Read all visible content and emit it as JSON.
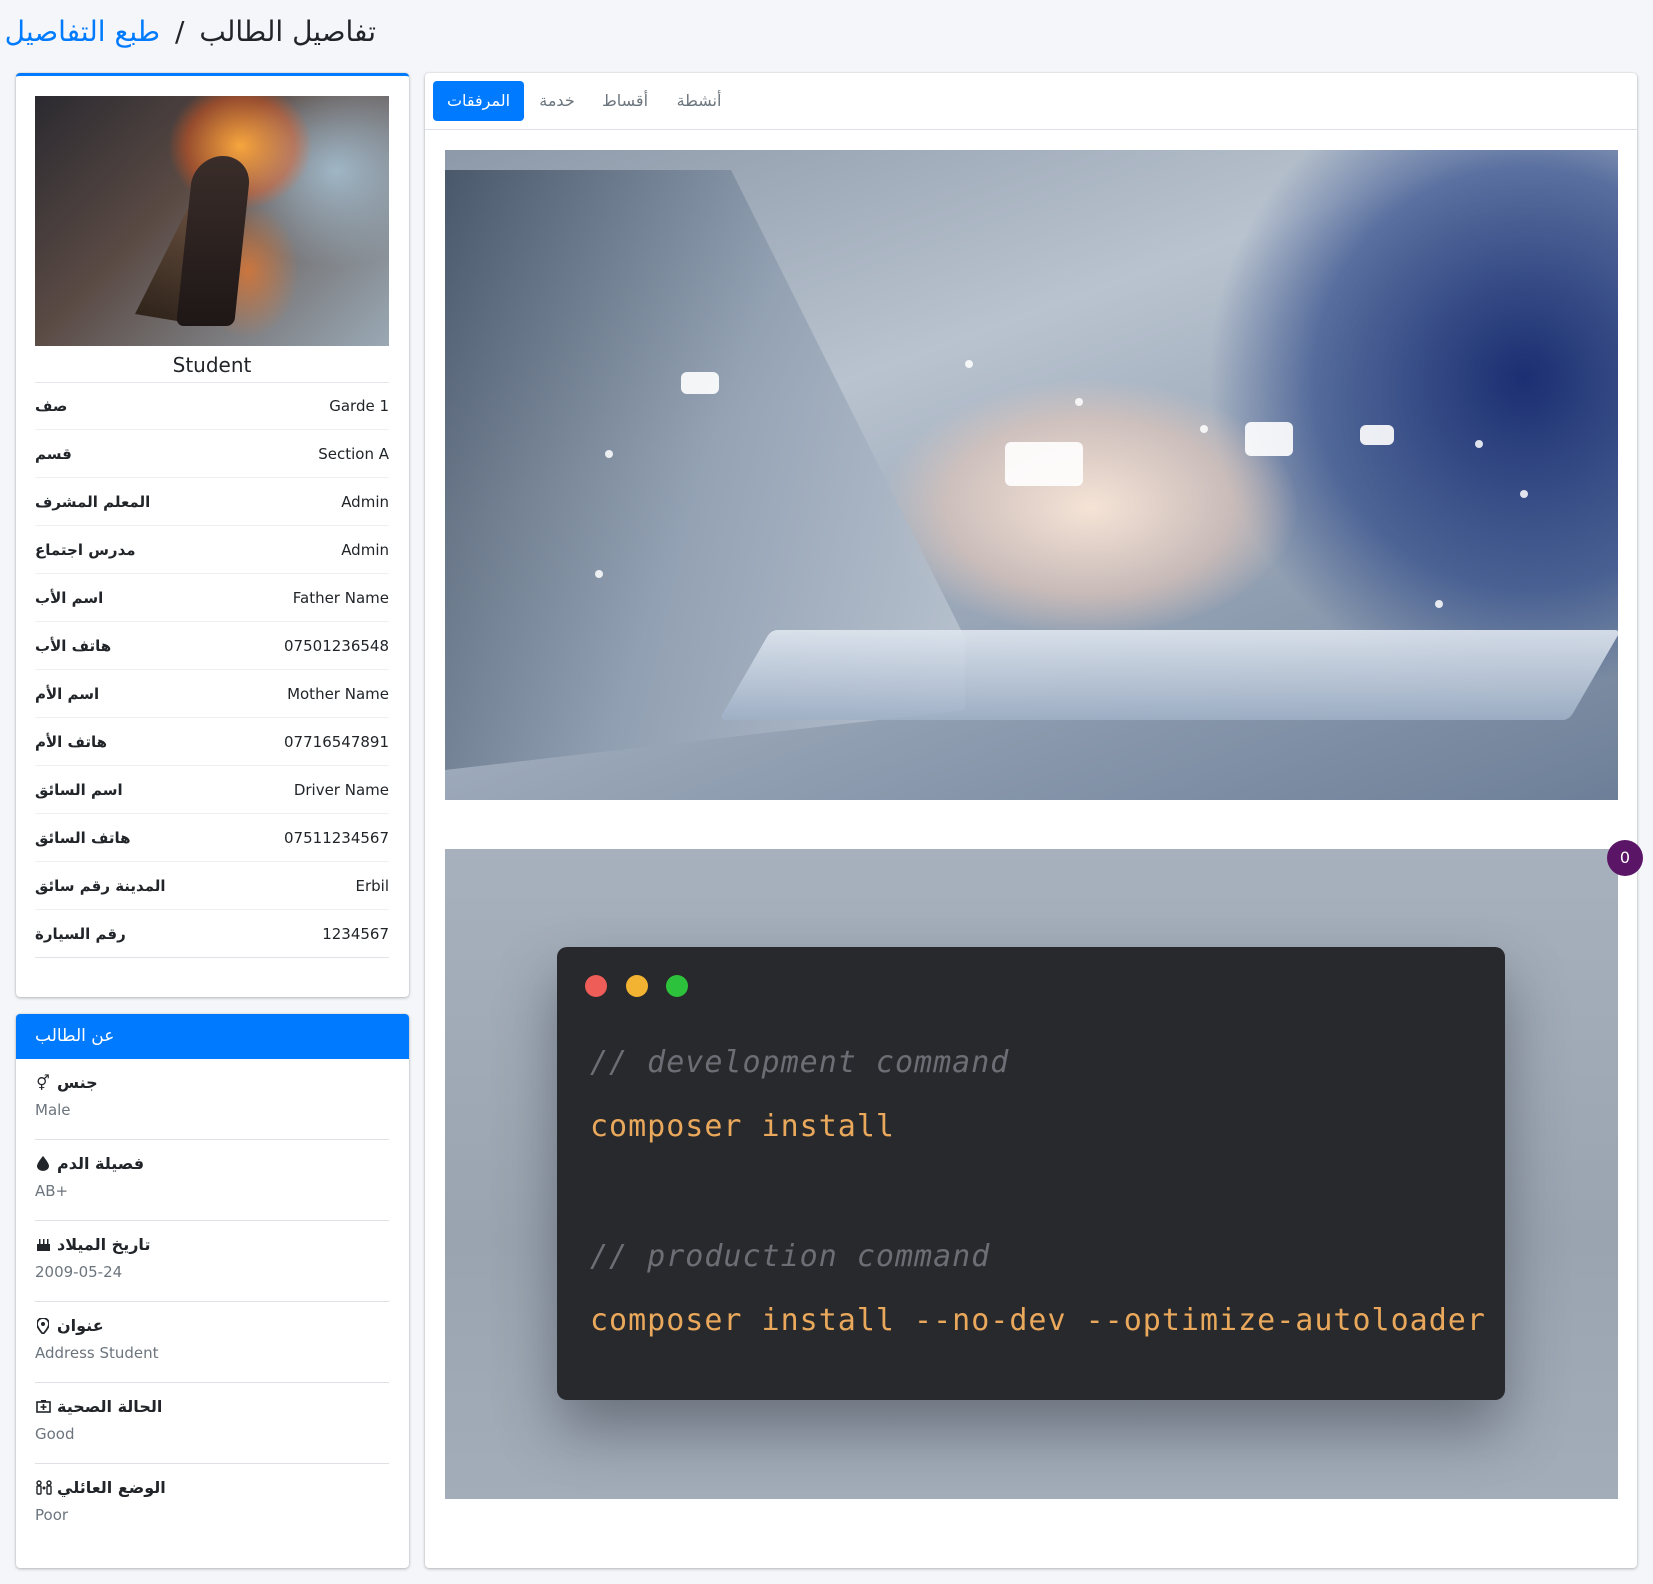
{
  "header": {
    "title": "تفاصيل الطالب",
    "separator": "/",
    "print_link": "طبع التفاصيل"
  },
  "profile": {
    "name": "Student",
    "rows": [
      {
        "label": "صف",
        "value": "Garde 1"
      },
      {
        "label": "قسم",
        "value": "Section A"
      },
      {
        "label": "المعلم المشرف",
        "value": "Admin"
      },
      {
        "label": "مدرس اجتماع",
        "value": "Admin"
      },
      {
        "label": "اسم الأب",
        "value": "Father Name"
      },
      {
        "label": "هاتف الأب",
        "value": "07501236548"
      },
      {
        "label": "اسم الأم",
        "value": "Mother Name"
      },
      {
        "label": "هاتف الأم",
        "value": "07716547891"
      },
      {
        "label": "اسم السائق",
        "value": "Driver Name"
      },
      {
        "label": "هاتف السائق",
        "value": "07511234567"
      },
      {
        "label": "المدينة رقم سائق",
        "value": "Erbil"
      },
      {
        "label": "رقم السيارة",
        "value": "1234567"
      }
    ]
  },
  "about": {
    "title": "عن الطالب",
    "items": [
      {
        "label": "جنس",
        "icon": "gender-icon",
        "value": "Male"
      },
      {
        "label": "فصيلة الدم",
        "icon": "blood-drop-icon",
        "value": "AB+"
      },
      {
        "label": "تاريخ الميلاد",
        "icon": "birthday-cake-icon",
        "value": "2009-05-24"
      },
      {
        "label": "عنوان",
        "icon": "map-pin-icon",
        "value": "Address Student"
      },
      {
        "label": "الحالة الصحية",
        "icon": "medical-kit-icon",
        "value": "Good"
      },
      {
        "label": "الوضع العائلي",
        "icon": "family-icon",
        "value": "Poor"
      }
    ]
  },
  "tabs": [
    {
      "label": "المرفقات",
      "active": true
    },
    {
      "label": "خدمة",
      "active": false
    },
    {
      "label": "أقساط",
      "active": false
    },
    {
      "label": "أنشطة",
      "active": false
    }
  ],
  "attachments": {
    "code_image": {
      "lines": [
        "// development command",
        "composer install",
        "// production command",
        "composer install --no-dev --optimize-autoloader"
      ]
    }
  },
  "notification_badge": "0",
  "colors": {
    "primary": "#007bff",
    "badge": "#5b1566",
    "terminal_bg": "#28292c",
    "code_orange": "#e9a85b"
  }
}
